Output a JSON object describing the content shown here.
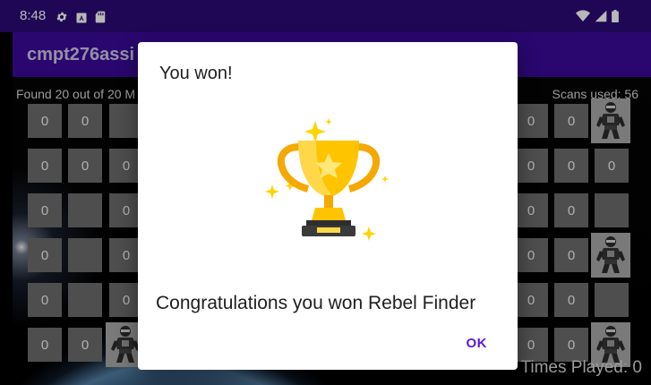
{
  "status_bar": {
    "time": "8:48",
    "left_icons": [
      "gear-icon",
      "text-a-icon",
      "sd-card-icon"
    ],
    "right_icons": [
      "wifi-icon",
      "signal-icon",
      "battery-icon"
    ]
  },
  "app_bar": {
    "title": "cmpt276assi"
  },
  "game": {
    "found_text": "Found 20 out of 20 M",
    "scans_text": "Scans used: 56",
    "times_played_text": "Times Played: 0",
    "left_grid": [
      [
        "0",
        "0",
        ""
      ],
      [
        "0",
        "0",
        "0"
      ],
      [
        "0",
        "",
        "0"
      ],
      [
        "0",
        "",
        "0"
      ],
      [
        "0",
        "",
        "0"
      ],
      [
        "0",
        "0",
        "robot"
      ]
    ],
    "right_grid": [
      [
        "0",
        "0",
        "robot"
      ],
      [
        "0",
        "0",
        "0"
      ],
      [
        "0",
        "0",
        ""
      ],
      [
        "0",
        "0",
        "robot"
      ],
      [
        "0",
        "0",
        ""
      ],
      [
        "0",
        "0",
        "robot"
      ]
    ]
  },
  "dialog": {
    "title": "You won!",
    "message": "Congratulations you won Rebel Finder",
    "ok_label": "OK",
    "icon": "trophy-icon"
  },
  "colors": {
    "status_bar": "#2c0a78",
    "app_bar": "#3a0a9a",
    "accent": "#5b18d9",
    "cell": "#6c6c6c"
  }
}
